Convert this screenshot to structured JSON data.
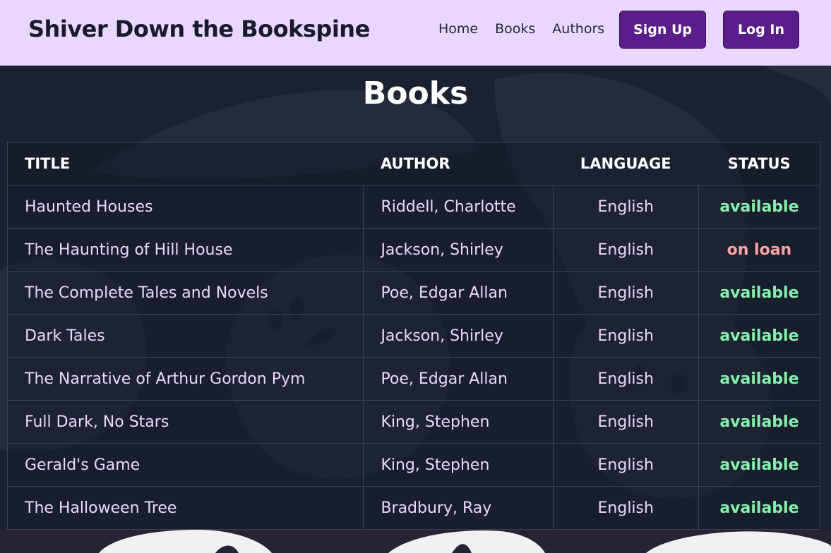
{
  "header": {
    "brand": "Shiver Down the Bookspine",
    "nav": [
      "Home",
      "Books",
      "Authors"
    ],
    "signup_label": "Sign Up",
    "login_label": "Log In"
  },
  "main": {
    "title": "Books",
    "columns": {
      "title": "TITLE",
      "author": "AUTHOR",
      "language": "LANGUAGE",
      "status": "STATUS"
    },
    "rows": [
      {
        "title": "Haunted Houses",
        "author": "Riddell, Charlotte",
        "language": "English",
        "status": "available"
      },
      {
        "title": "The Haunting of Hill House",
        "author": "Jackson, Shirley",
        "language": "English",
        "status": "on loan"
      },
      {
        "title": "The Complete Tales and Novels",
        "author": "Poe, Edgar Allan",
        "language": "English",
        "status": "available"
      },
      {
        "title": "Dark Tales",
        "author": "Jackson, Shirley",
        "language": "English",
        "status": "available"
      },
      {
        "title": "The Narrative of Arthur Gordon Pym",
        "author": "Poe, Edgar Allan",
        "language": "English",
        "status": "available"
      },
      {
        "title": "Full Dark, No Stars",
        "author": "King, Stephen",
        "language": "English",
        "status": "available"
      },
      {
        "title": "Gerald's Game",
        "author": "King, Stephen",
        "language": "English",
        "status": "available"
      },
      {
        "title": "The Halloween Tree",
        "author": "Bradbury, Ray",
        "language": "English",
        "status": "available"
      }
    ]
  },
  "colors": {
    "header_bg": "#ead7fd",
    "button_bg": "#5b1d8a",
    "available": "#86efac",
    "on_loan": "#fca5a5",
    "page_bg": "#1b2130"
  },
  "icons": [
    "ghost-icon"
  ]
}
